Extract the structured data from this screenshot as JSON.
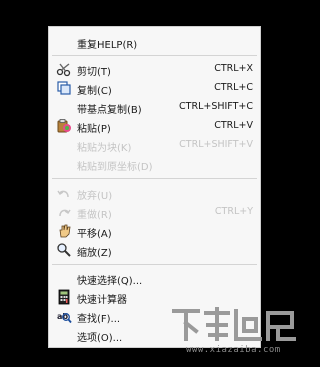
{
  "menu": {
    "items": [
      {
        "label": "重复HELP(R)",
        "shortcut": "",
        "disabled": false,
        "icon": null
      },
      {
        "label": "剪切(T)",
        "shortcut": "CTRL+X",
        "disabled": false,
        "icon": "scissors-icon"
      },
      {
        "label": "复制(C)",
        "shortcut": "CTRL+C",
        "disabled": false,
        "icon": "copy-icon"
      },
      {
        "label": "带基点复制(B)",
        "shortcut": "CTRL+SHIFT+C",
        "disabled": false,
        "icon": null
      },
      {
        "label": "粘贴(P)",
        "shortcut": "CTRL+V",
        "disabled": false,
        "icon": "paste-icon"
      },
      {
        "label": "粘贴为块(K)",
        "shortcut": "CTRL+SHIFT+V",
        "disabled": true,
        "icon": null
      },
      {
        "label": "粘贴到原坐标(D)",
        "shortcut": "",
        "disabled": true,
        "icon": null
      },
      {
        "label": "放弃(U)",
        "shortcut": "",
        "disabled": true,
        "icon": "undo-icon"
      },
      {
        "label": "重做(R)",
        "shortcut": "CTRL+Y",
        "disabled": true,
        "icon": "redo-icon"
      },
      {
        "label": "平移(A)",
        "shortcut": "",
        "disabled": false,
        "icon": "pan-icon"
      },
      {
        "label": "缩放(Z)",
        "shortcut": "",
        "disabled": false,
        "icon": "zoom-icon"
      },
      {
        "label": "快速选择(Q)...",
        "shortcut": "",
        "disabled": false,
        "icon": null
      },
      {
        "label": "快速计算器",
        "shortcut": "",
        "disabled": false,
        "icon": "calculator-icon"
      },
      {
        "label": "查找(F)...",
        "shortcut": "",
        "disabled": false,
        "icon": "find-icon"
      },
      {
        "label": "选项(O)...",
        "shortcut": "",
        "disabled": false,
        "icon": null
      }
    ]
  },
  "watermark": {
    "url": "www.xiazaiba.com"
  },
  "colors": {
    "background": "#000000",
    "menu_bg": "#f7f7f7",
    "disabled_text": "#c4c4c4"
  }
}
